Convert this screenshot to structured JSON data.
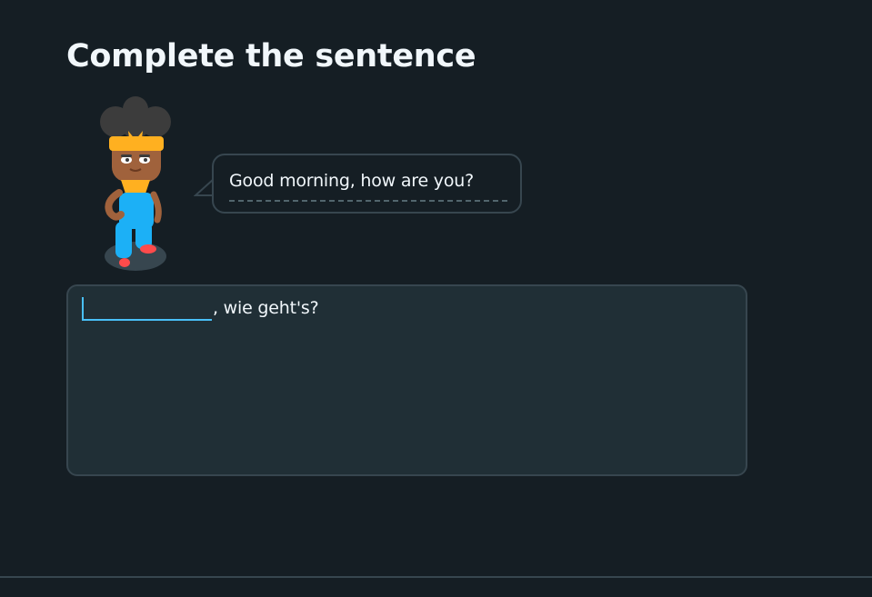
{
  "challenge": {
    "title": "Complete the sentence"
  },
  "prompt": {
    "speech_text": "Good morning, how are you?"
  },
  "answer": {
    "blank_value": "",
    "sentence_rest": ", wie geht's?"
  },
  "character": {
    "icon": "character-illustration"
  },
  "colors": {
    "background": "#151e24",
    "panel": "#202f36",
    "border": "#37464f",
    "accent": "#49c0f8",
    "text": "#f1f7fb"
  }
}
